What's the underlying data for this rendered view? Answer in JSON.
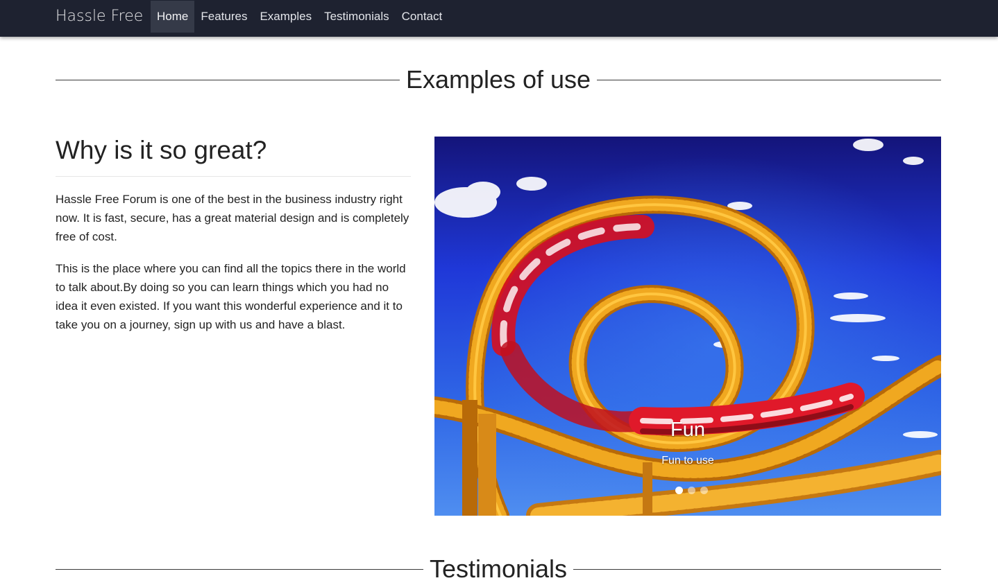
{
  "navbar": {
    "brand": "Hassle Free",
    "items": [
      {
        "label": "Home",
        "active": true
      },
      {
        "label": "Features",
        "active": false
      },
      {
        "label": "Examples",
        "active": false
      },
      {
        "label": "Testimonials",
        "active": false
      },
      {
        "label": "Contact",
        "active": false
      }
    ]
  },
  "examples": {
    "heading": "Examples of use",
    "why_title": "Why is it so great?",
    "paragraphs": [
      "Hassle Free Forum is one of the best in the business industry right now. It is fast, secure, has a great material design and is completely free of cost.",
      "This is the place where you can find all the topics there in the world to talk about.By doing so you can learn things which you had no idea it even existed. If you want this wonderful experience and it to take you on a journey, sign up with us and have a blast."
    ],
    "carousel": {
      "caption_title": "Fun",
      "caption_text": "Fun to use",
      "slide_count": 3,
      "active_index": 0
    }
  },
  "testimonials": {
    "heading": "Testimonials"
  },
  "colors": {
    "navbar_bg": "#1e2230",
    "nav_active_bg": "#353a48",
    "sky": "#1a2fd0",
    "track": "#f0a820",
    "train": "#e0192a"
  }
}
